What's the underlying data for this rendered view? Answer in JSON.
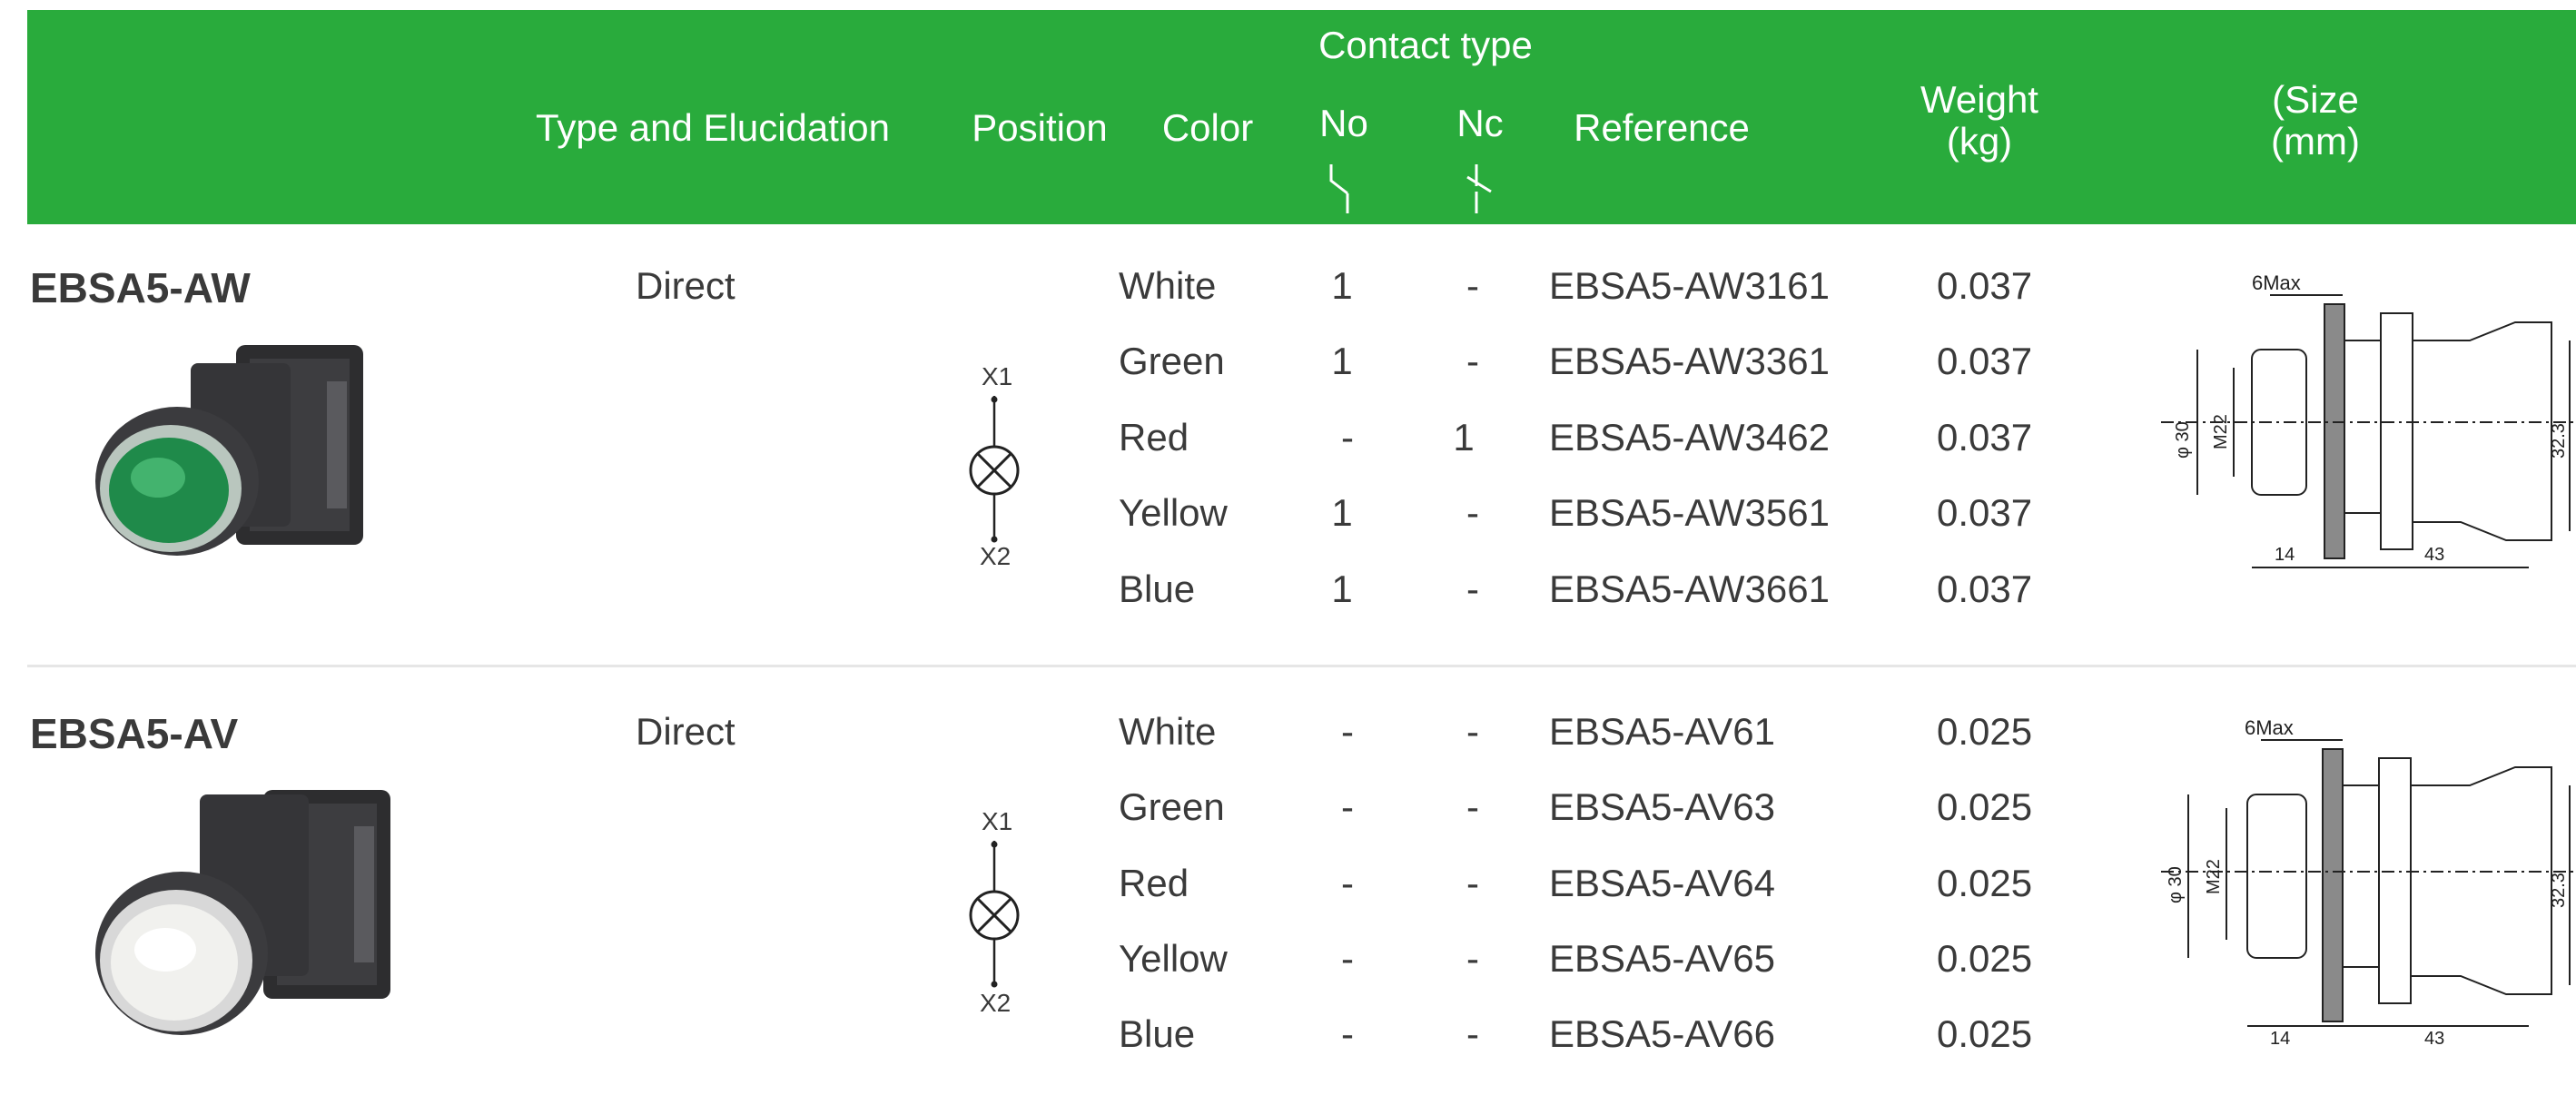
{
  "header": {
    "type_label": "Type and Elucidation",
    "position_label": "Position",
    "color_label": "Color",
    "contact_type_label": "Contact type",
    "no_label": "No",
    "nc_label": "Nc",
    "reference_label": "Reference",
    "weight_label_1": "Weight",
    "weight_label_2": "(kg)",
    "size_label_1": "(Size",
    "size_label_2": "(mm)"
  },
  "colors": {
    "header_bg": "#29ab3c",
    "divider": "#e6e6e6"
  },
  "groups": [
    {
      "model": "EBSA5-AW",
      "type": "Direct",
      "lamp_symbol": {
        "top": "X1",
        "bottom": "X2"
      },
      "rows": [
        {
          "color": "White",
          "no": "1",
          "nc": "-",
          "reference": "EBSA5-AW3161",
          "weight": "0.037"
        },
        {
          "color": "Green",
          "no": "1",
          "nc": "-",
          "reference": "EBSA5-AW3361",
          "weight": "0.037"
        },
        {
          "color": "Red",
          "no": "-",
          "nc": "1",
          "reference": "EBSA5-AW3462",
          "weight": "0.037"
        },
        {
          "color": "Yellow",
          "no": "1",
          "nc": "-",
          "reference": "EBSA5-AW3561",
          "weight": "0.037"
        },
        {
          "color": "Blue",
          "no": "1",
          "nc": "-",
          "reference": "EBSA5-AW3661",
          "weight": "0.037"
        }
      ],
      "drawing": {
        "max": "6Max",
        "dia": "φ 30",
        "thread": "M22",
        "h": "32.3",
        "l1": "14",
        "l2": "43"
      }
    },
    {
      "model": "EBSA5-AV",
      "type": "Direct",
      "lamp_symbol": {
        "top": "X1",
        "bottom": "X2"
      },
      "rows": [
        {
          "color": "White",
          "no": "-",
          "nc": "-",
          "reference": "EBSA5-AV61",
          "weight": "0.025"
        },
        {
          "color": "Green",
          "no": "-",
          "nc": "-",
          "reference": "EBSA5-AV63",
          "weight": "0.025"
        },
        {
          "color": "Red",
          "no": "-",
          "nc": "-",
          "reference": "EBSA5-AV64",
          "weight": "0.025"
        },
        {
          "color": "Yellow",
          "no": "-",
          "nc": "-",
          "reference": "EBSA5-AV65",
          "weight": "0.025"
        },
        {
          "color": "Blue",
          "no": "-",
          "nc": "-",
          "reference": "EBSA5-AV66",
          "weight": "0.025"
        }
      ],
      "drawing": {
        "max": "6Max",
        "dia": "φ 30",
        "thread": "M22",
        "h": "32.3",
        "l1": "14",
        "l2": "43"
      }
    }
  ]
}
